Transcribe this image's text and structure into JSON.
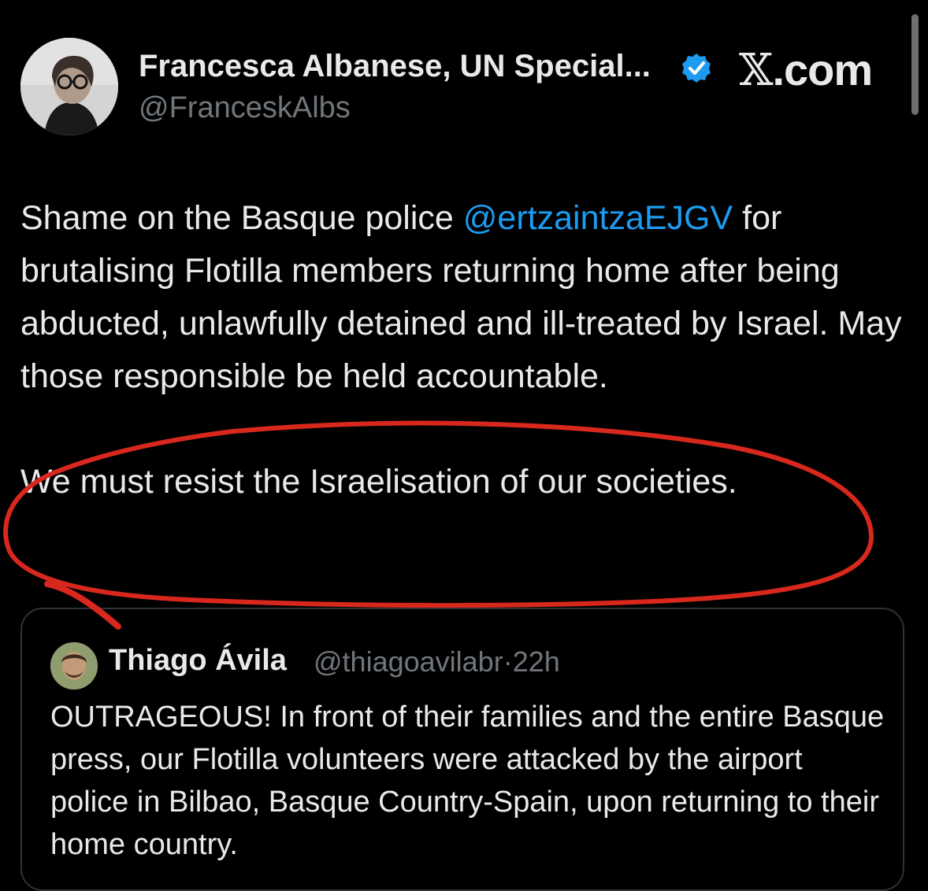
{
  "header": {
    "display_name": "Francesca Albanese, UN Special...",
    "handle": "@FranceskAlbs",
    "site_logo_mark": "𝕏",
    "site_logo_suffix": ".com",
    "verified_color": "#1d9bf0"
  },
  "tweet": {
    "text_before_mention": "Shame on the Basque police ",
    "mention": "@ertzaintzaEJGV",
    "text_after_mention": " for brutalising Flotilla members returning home after being abducted, unlawfully detained and ill-treated by Israel. May those responsible be held accountable.",
    "paragraph2": "We must resist the Israelisation of our societies."
  },
  "quoted_tweet": {
    "display_name": "Thiago Ávila",
    "handle": "@thiagoavilabr",
    "separator": "·",
    "time": "22h",
    "text": "OUTRAGEOUS! In front of their families and the entire Basque press, our Flotilla volunteers were attacked by the airport police in Bilbao, Basque Country-Spain, upon returning to their home country."
  },
  "colors": {
    "background": "#000000",
    "text": "#e7e9ea",
    "secondary_text": "#71767b",
    "link": "#1d9bf0",
    "annotation_circle": "#d8281e"
  }
}
